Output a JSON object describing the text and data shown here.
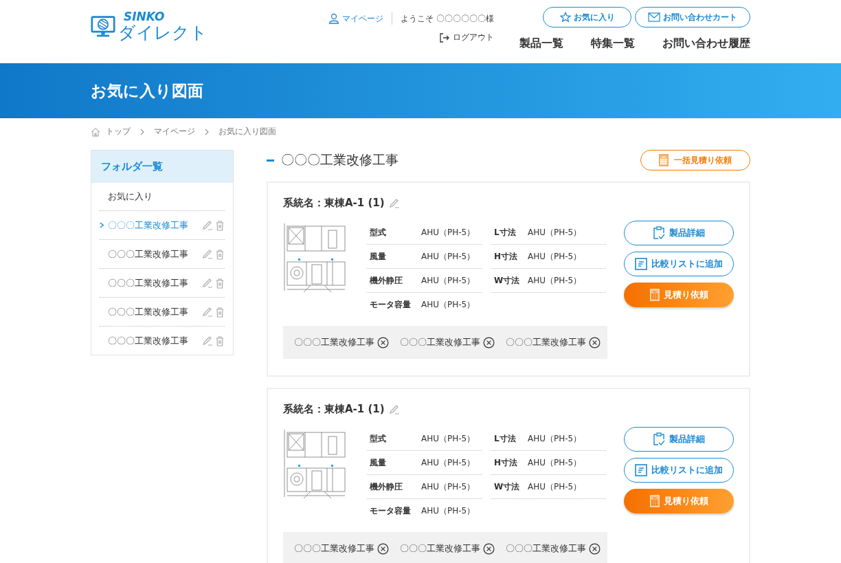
{
  "header": {
    "logo_top": "SINKO",
    "logo_bottom": "ダイレクト",
    "mypage": "マイページ",
    "welcome": "ようこそ 〇〇〇〇〇〇様",
    "logout": "ログアウト",
    "favorites_button": "お気に入り",
    "cart_button": "お問い合わせカート",
    "nav": [
      "製品一覧",
      "特集一覧",
      "お問い合わせ履歴"
    ]
  },
  "banner": {
    "title": "お気に入り図面"
  },
  "breadcrumb": [
    "トップ",
    "マイページ",
    "お気に入り図面"
  ],
  "sidebar": {
    "title": "フォルダ一覧",
    "favorites": "お気に入り",
    "folders": [
      {
        "label": "〇〇〇工業改修工事",
        "selected": true
      },
      {
        "label": "〇〇〇工業改修工事",
        "selected": false
      },
      {
        "label": "〇〇〇工業改修工事",
        "selected": false
      },
      {
        "label": "〇〇〇工業改修工事",
        "selected": false
      },
      {
        "label": "〇〇〇工業改修工事",
        "selected": false
      }
    ]
  },
  "main": {
    "title": "〇〇〇工業改修工事",
    "bulk_button": "一括見積り依頼",
    "cards": [
      {
        "system": "系統名：東棟A-1 (1)",
        "specs_left": [
          {
            "label": "型式",
            "value": "AHU（PH-5）"
          },
          {
            "label": "風量",
            "value": "AHU（PH-5）"
          },
          {
            "label": "機外静圧",
            "value": "AHU（PH-5）"
          },
          {
            "label": "モータ容量",
            "value": "AHU（PH-5）"
          }
        ],
        "specs_right": [
          {
            "label": "L寸法",
            "value": "AHU（PH-5）"
          },
          {
            "label": "H寸法",
            "value": "AHU（PH-5）"
          },
          {
            "label": "W寸法",
            "value": "AHU（PH-5）"
          }
        ],
        "buttons": [
          "製品詳細",
          "比較リストに追加",
          "見積り依頼"
        ],
        "tags": [
          "〇〇〇工業改修工事",
          "〇〇〇工業改修工事",
          "〇〇〇工業改修工事"
        ]
      },
      {
        "system": "系統名：東棟A-1 (1)",
        "specs_left": [
          {
            "label": "型式",
            "value": "AHU（PH-5）"
          },
          {
            "label": "風量",
            "value": "AHU（PH-5）"
          },
          {
            "label": "機外静圧",
            "value": "AHU（PH-5）"
          },
          {
            "label": "モータ容量",
            "value": "AHU（PH-5）"
          }
        ],
        "specs_right": [
          {
            "label": "L寸法",
            "value": "AHU（PH-5）"
          },
          {
            "label": "H寸法",
            "value": "AHU（PH-5）"
          },
          {
            "label": "W寸法",
            "value": "AHU（PH-5）"
          }
        ],
        "buttons": [
          "製品詳細",
          "比較リストに追加",
          "見積り依頼"
        ],
        "tags": [
          "〇〇〇工業改修工事",
          "〇〇〇工業改修工事",
          "〇〇〇工業改修工事"
        ]
      }
    ]
  }
}
